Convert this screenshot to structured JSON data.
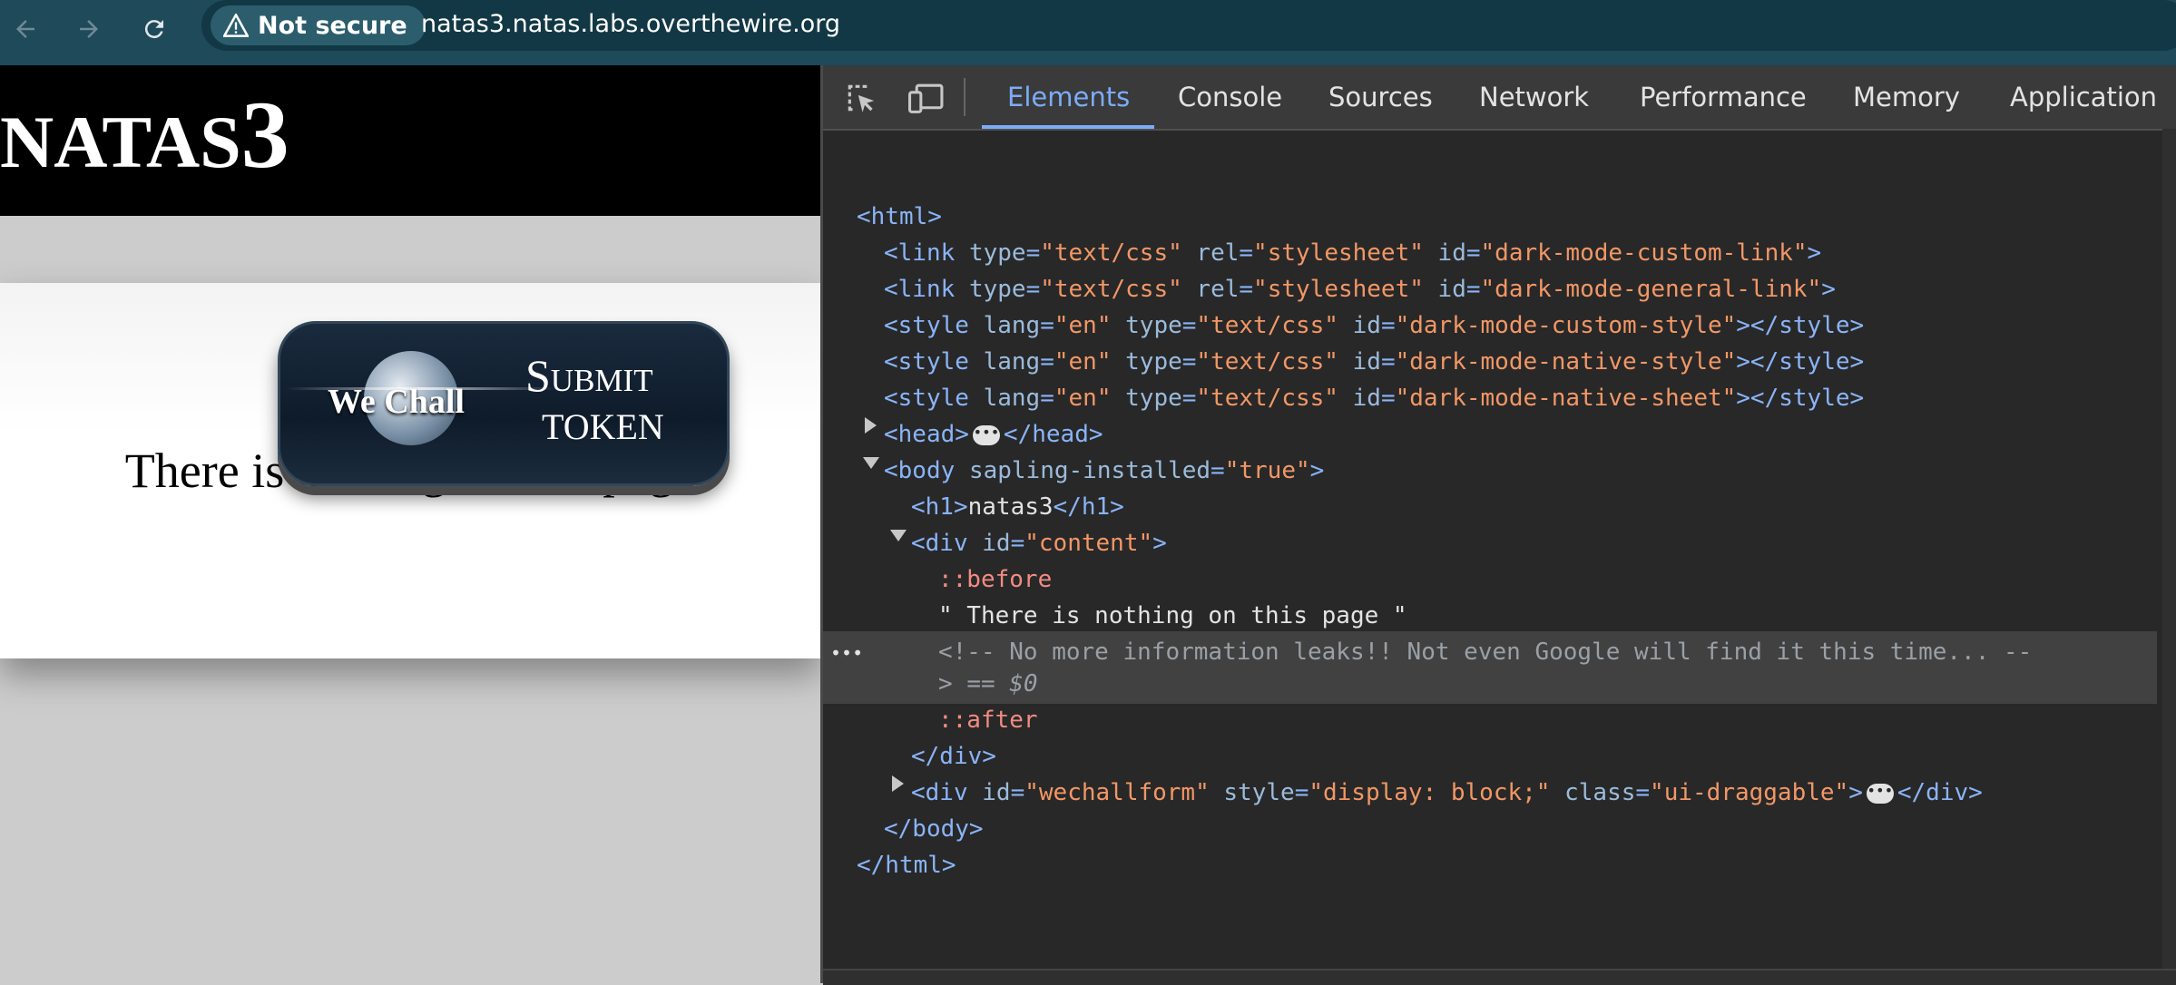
{
  "browser": {
    "security_label": "Not secure",
    "url": "natas3.natas.labs.overthewire.org",
    "icons": [
      "back-arrow-icon",
      "forward-arrow-icon",
      "reload-icon",
      "warning-triangle-icon"
    ]
  },
  "page": {
    "title_prefix": "NATAS",
    "title_suffix": "3",
    "content_text": "There is nothing on this page",
    "wechall": {
      "brand": "We Chall",
      "submit": "Submit",
      "token": "TOKEN"
    }
  },
  "devtools": {
    "tabs": [
      "Elements",
      "Console",
      "Sources",
      "Network",
      "Performance",
      "Memory",
      "Application"
    ],
    "active_tab": "Elements",
    "tool_icons": [
      "inspect-element-icon",
      "device-toolbar-icon"
    ],
    "dom": {
      "html_open": "<html>",
      "link1": {
        "tag": "<link",
        "type_attr": "type",
        "type_val": "\"text/css\"",
        "rel_attr": "rel",
        "rel_val": "\"stylesheet\"",
        "id_attr": "id",
        "id_val": "\"dark-mode-custom-link\"",
        "close": ">"
      },
      "link2": {
        "tag": "<link",
        "type_attr": "type",
        "type_val": "\"text/css\"",
        "rel_attr": "rel",
        "rel_val": "\"stylesheet\"",
        "id_attr": "id",
        "id_val": "\"dark-mode-general-link\"",
        "close": ">"
      },
      "style1": {
        "tag": "<style",
        "lang_attr": "lang",
        "lang_val": "\"en\"",
        "type_attr": "type",
        "type_val": "\"text/css\"",
        "id_attr": "id",
        "id_val": "\"dark-mode-custom-style\"",
        "close": "></style>"
      },
      "style2": {
        "tag": "<style",
        "lang_attr": "lang",
        "lang_val": "\"en\"",
        "type_attr": "type",
        "type_val": "\"text/css\"",
        "id_attr": "id",
        "id_val": "\"dark-mode-native-style\"",
        "close": "></style>"
      },
      "style3": {
        "tag": "<style",
        "lang_attr": "lang",
        "lang_val": "\"en\"",
        "type_attr": "type",
        "type_val": "\"text/css\"",
        "id_attr": "id",
        "id_val": "\"dark-mode-native-sheet\"",
        "close": "></style>"
      },
      "head_open": "<head>",
      "head_close": "</head>",
      "body_tag": "<body",
      "body_attr": "sapling-installed",
      "body_val": "\"true\"",
      "body_close": ">",
      "h1_open": "<h1>",
      "h1_text": "natas3",
      "h1_close": "</h1>",
      "div_tag": "<div",
      "div_id_attr": "id",
      "div_id_val": "\"content\"",
      "div_close_bracket": ">",
      "before": "::before",
      "text_node": "\" There is nothing on this page \"",
      "comment_line1": "<!-- No more information leaks!! Not even Google will find it this time... --",
      "comment_line2": ">",
      "selected_marker": "== $0",
      "after": "::after",
      "div_end": "</div>",
      "wechall_tag": "<div",
      "wechall_id_attr": "id",
      "wechall_id_val": "\"wechallform\"",
      "wechall_style_attr": "style",
      "wechall_style_val": "\"display: block;\"",
      "wechall_class_attr": "class",
      "wechall_class_val": "\"ui-draggable\"",
      "wechall_open_close": ">",
      "wechall_end": "</div>",
      "body_end": "</body>",
      "html_end": "</html>",
      "row_ellipsis": "•••"
    }
  },
  "colors": {
    "toolbar": "#1e4a5a",
    "devtools_bg": "#282828",
    "tag": "#8ab4f8",
    "attr_value": "#f29766",
    "pseudo": "#f28b82",
    "active_tab": "#7cacf8"
  }
}
